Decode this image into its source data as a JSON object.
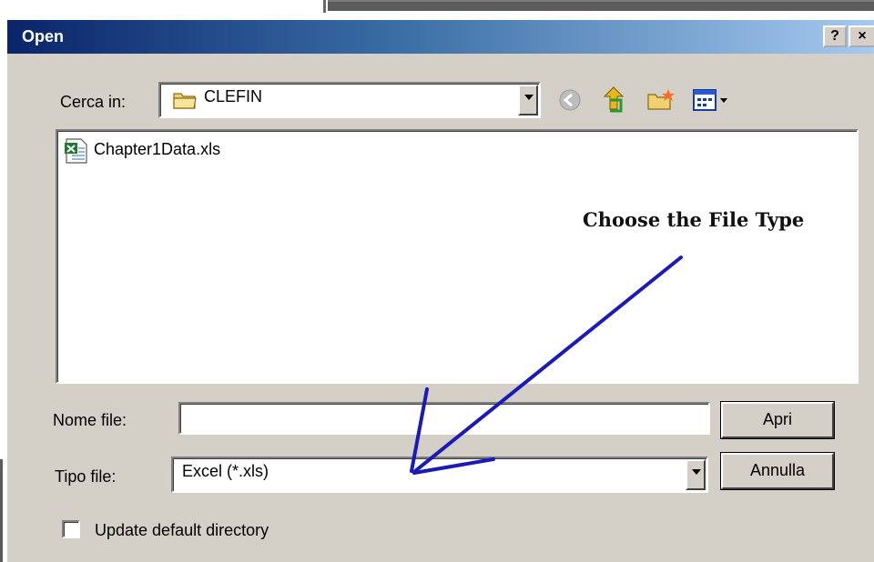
{
  "dialog": {
    "title": "Open",
    "help_label": "?",
    "close_label": "×"
  },
  "look_in": {
    "label": "Cerca in:",
    "value": "CLEFIN"
  },
  "toolbar": {
    "icons": [
      "back-icon",
      "up-folder-icon",
      "new-folder-icon",
      "view-menu-icon"
    ]
  },
  "file_list": {
    "items": [
      {
        "name": "Chapter1Data.xls",
        "icon": "excel-file-icon"
      }
    ]
  },
  "filename": {
    "label": "Nome file:",
    "value": ""
  },
  "filetype": {
    "label": "Tipo file:",
    "value": "Excel (*.xls)"
  },
  "buttons": {
    "open_label": "Apri",
    "cancel_label": "Annulla"
  },
  "checkbox": {
    "label": "Update default directory",
    "checked": false
  },
  "annotation": {
    "text": "Choose the File Type",
    "arrow_color": "#1a1ab8"
  },
  "colors": {
    "title_start": "#0a246a",
    "title_end": "#a6caf0",
    "dialog_bg": "#d4d0c8"
  }
}
